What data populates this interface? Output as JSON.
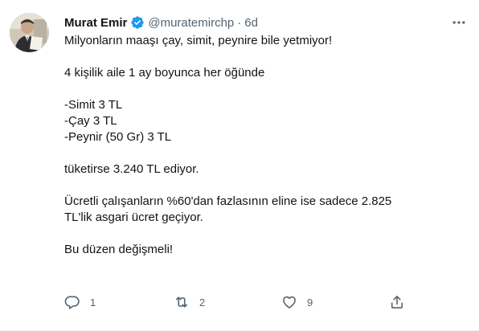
{
  "tweet": {
    "display_name": "Murat Emir",
    "handle": "@muratemirchp",
    "separator": "·",
    "time": "6d",
    "lines": [
      "Milyonların maaşı çay, simit, peynire bile yetmiyor!",
      "",
      "4 kişilik aile 1 ay boyunca her öğünde",
      "",
      "-Simit 3 TL",
      "-Çay 3 TL",
      "-Peynir (50 Gr) 3 TL",
      "",
      "tüketirse 3.240 TL ediyor.",
      "",
      "Ücretli çalışanların %60'dan fazlasının eline ise sadece 2.825",
      "TL'lik asgari ücret geçiyor.",
      "",
      "Bu düzen değişmeli!"
    ],
    "reply_count": "1",
    "retweet_count": "2",
    "like_count": "9"
  },
  "colors": {
    "verified_blue": "#1d9bf0",
    "muted": "#536471",
    "text": "#0f1419"
  },
  "icons": {
    "verified": "verified-badge-icon",
    "more": "more-dots-icon",
    "reply": "reply-icon",
    "retweet": "retweet-icon",
    "like": "heart-icon",
    "share": "share-icon"
  }
}
